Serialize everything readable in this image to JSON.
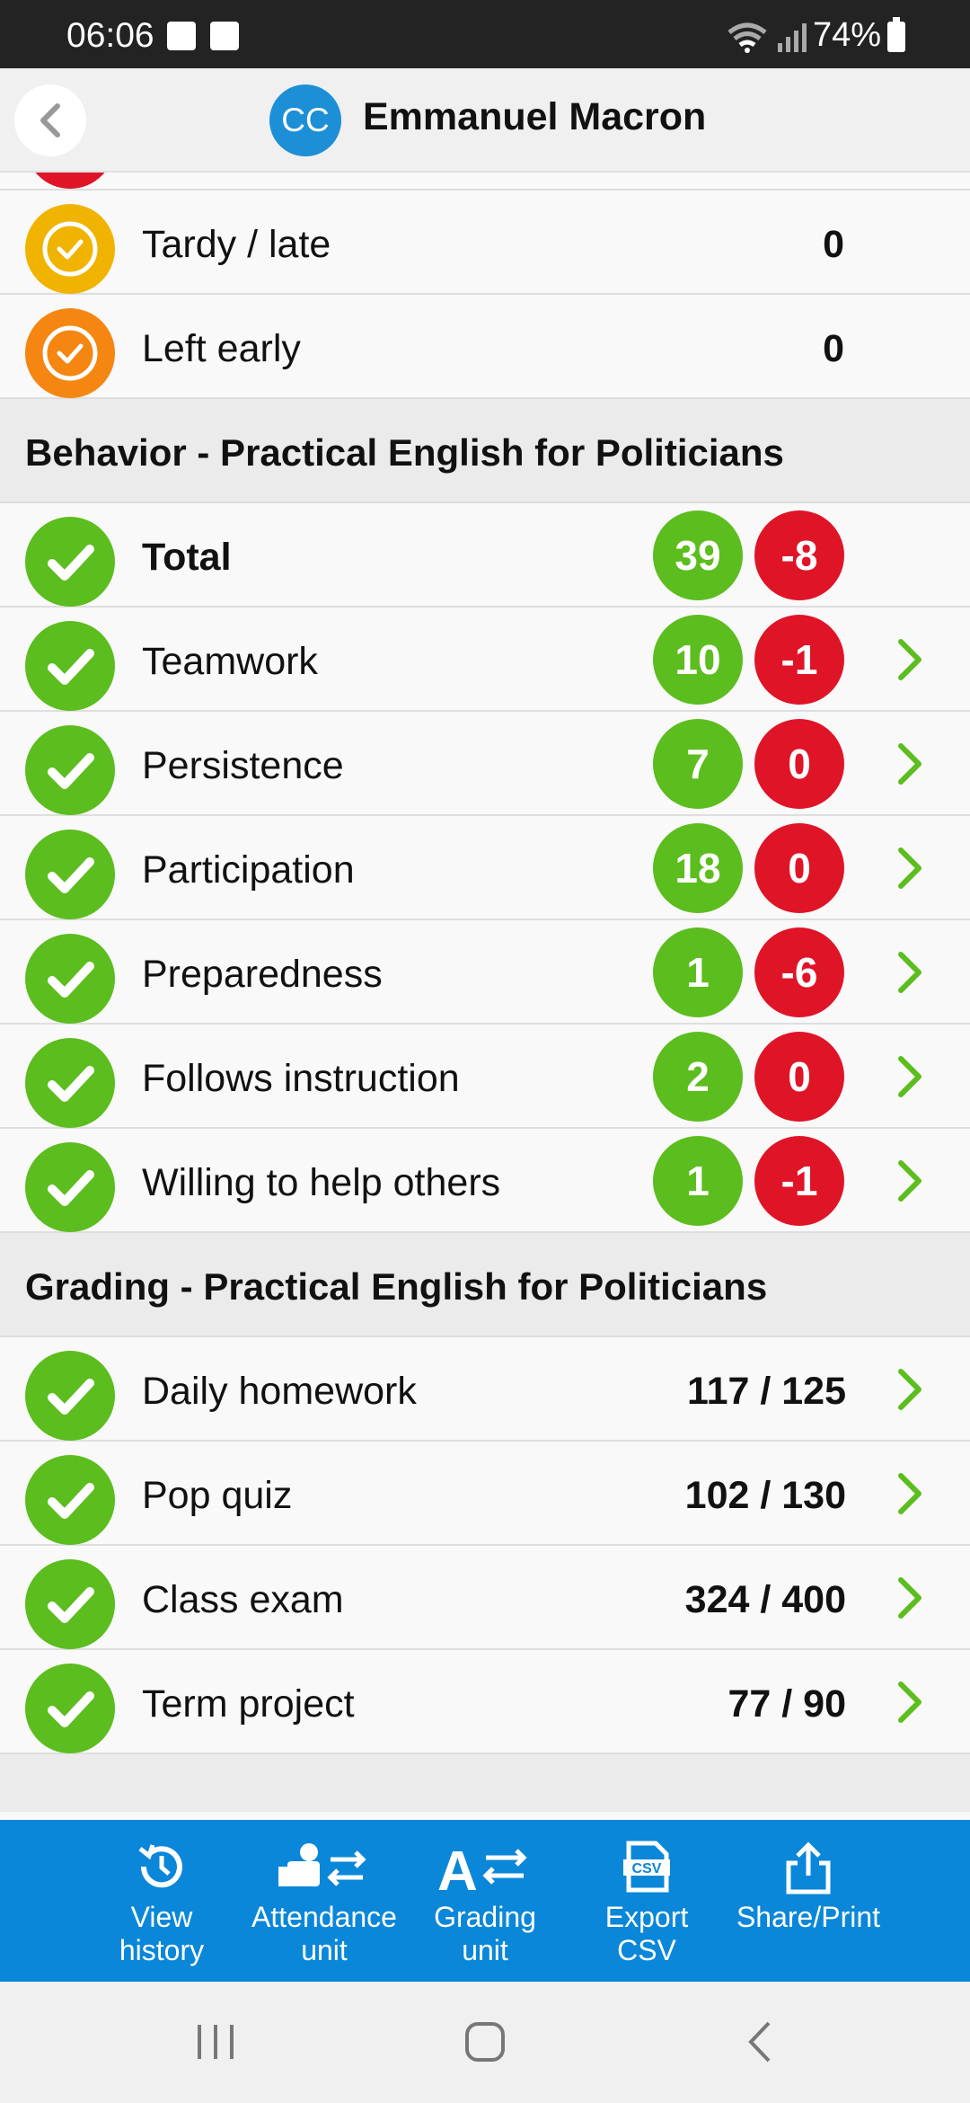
{
  "status_bar": {
    "time": "06:06",
    "battery": "74%"
  },
  "header": {
    "avatar_initials": "CC",
    "student_name": "Emmanuel Macron"
  },
  "attendance": [
    {
      "label": "Tardy / late",
      "value": "0",
      "color": "#f0b400"
    },
    {
      "label": "Left early",
      "value": "0",
      "color": "#f58611"
    }
  ],
  "behavior": {
    "title": "Behavior - Practical English for Politicians",
    "rows": [
      {
        "label": "Total",
        "positive": "39",
        "negative": "-8",
        "bold": true,
        "chevron": false
      },
      {
        "label": "Teamwork",
        "positive": "10",
        "negative": "-1",
        "chevron": true
      },
      {
        "label": "Persistence",
        "positive": "7",
        "negative": "0",
        "chevron": true
      },
      {
        "label": "Participation",
        "positive": "18",
        "negative": "0",
        "chevron": true
      },
      {
        "label": "Preparedness",
        "positive": "1",
        "negative": "-6",
        "chevron": true
      },
      {
        "label": "Follows instruction",
        "positive": "2",
        "negative": "0",
        "chevron": true
      },
      {
        "label": "Willing to help others",
        "positive": "1",
        "negative": "-1",
        "chevron": true
      }
    ]
  },
  "grading": {
    "title": "Grading - Practical English for Politicians",
    "rows": [
      {
        "label": "Daily homework",
        "score": "117 / 125"
      },
      {
        "label": "Pop quiz",
        "score": "102 / 130"
      },
      {
        "label": "Class exam",
        "score": "324 / 400"
      },
      {
        "label": "Term project",
        "score": "77 / 90"
      }
    ]
  },
  "toolbar": {
    "view_history": [
      "View",
      "history"
    ],
    "attendance_unit": [
      "Attendance",
      "unit"
    ],
    "grading_unit": [
      "Grading",
      "unit"
    ],
    "export_csv": [
      "Export",
      "CSV"
    ],
    "share_print": [
      "Share/Print"
    ]
  },
  "icons": {
    "positive_color": "#5cbd1e",
    "negative_color": "#e01427",
    "toolbar_color": "#0a87d8"
  }
}
